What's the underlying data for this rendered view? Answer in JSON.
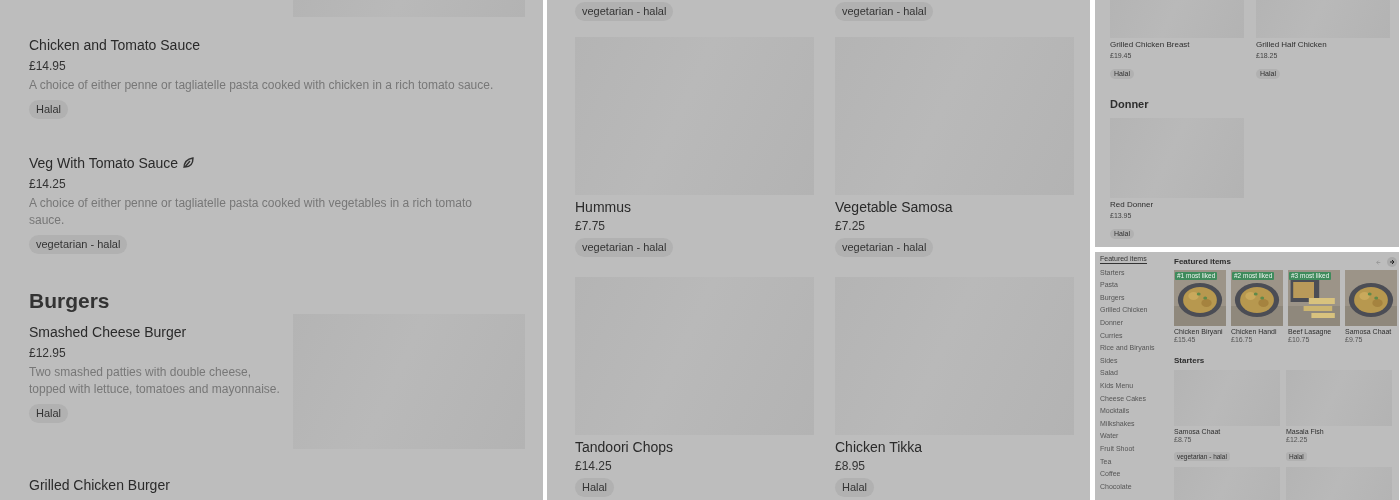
{
  "list_view": {
    "sections": [
      {
        "items": [
          {
            "kind": "cut",
            "has_image": true
          },
          {
            "kind": "full",
            "name": "Chicken and Tomato Sauce",
            "vegetarian": false,
            "price": "£14.95",
            "description": "A choice of either penne or tagliatelle pasta cooked with chicken in a rich tomato sauce.",
            "tags": [
              "Halal"
            ],
            "has_image": false
          },
          {
            "kind": "full",
            "name": "Veg With Tomato Sauce",
            "vegetarian": true,
            "price": "£14.25",
            "description": "A choice of either penne or tagliatelle pasta cooked with vegetables in a rich tomato sauce.",
            "tags": [
              "vegetarian - halal"
            ],
            "has_image": false
          }
        ]
      },
      {
        "heading": "Burgers",
        "items": [
          {
            "kind": "full",
            "name": "Smashed Cheese Burger",
            "vegetarian": false,
            "price": "£12.95",
            "description": "Two smashed patties with double cheese, topped with lettuce, tomatoes and mayonnaise.",
            "tags": [
              "Halal"
            ],
            "has_image": true
          },
          {
            "kind": "title_only",
            "name": "Grilled Chicken Burger"
          }
        ]
      }
    ]
  },
  "grid_view": {
    "rows": [
      [
        {
          "kind": "cut",
          "tags": [
            "vegetarian - halal"
          ]
        },
        {
          "kind": "cut",
          "tags": [
            "vegetarian - halal"
          ]
        }
      ],
      [
        {
          "kind": "full",
          "name": "Hummus",
          "price": "£7.75",
          "tags": [
            "vegetarian - halal"
          ]
        },
        {
          "kind": "full",
          "name": "Vegetable Samosa",
          "price": "£7.25",
          "tags": [
            "vegetarian - halal"
          ]
        }
      ],
      [
        {
          "kind": "full",
          "name": "Tandoori Chops",
          "price": "£14.25",
          "tags": [
            "Halal"
          ]
        },
        {
          "kind": "full",
          "name": "Chicken Tikka",
          "price": "£8.95",
          "tags": [
            "Halal"
          ]
        }
      ]
    ]
  },
  "small_grid_view": {
    "sections": [
      {
        "cards": [
          {
            "kind": "cut",
            "name": "Grilled Chicken Breast",
            "price": "£19.45",
            "tags": [
              "Halal"
            ]
          },
          {
            "kind": "cut",
            "name": "Grilled Half Chicken",
            "price": "£18.25",
            "tags": [
              "Halal"
            ]
          }
        ]
      },
      {
        "heading": "Donner",
        "cards": [
          {
            "kind": "full",
            "name": "Red Donner",
            "price": "£13.95",
            "tags": [
              "Halal"
            ]
          }
        ]
      }
    ]
  },
  "overview": {
    "sidebar": {
      "items": [
        {
          "label": "Featured items",
          "selected": true
        },
        {
          "label": "Starters",
          "selected": false
        },
        {
          "label": "Pasta",
          "selected": false
        },
        {
          "label": "Burgers",
          "selected": false
        },
        {
          "label": "Grilled Chicken",
          "selected": false
        },
        {
          "label": "Donner",
          "selected": false
        },
        {
          "label": "Curries",
          "selected": false
        },
        {
          "label": "Rice and Biryanis",
          "selected": false
        },
        {
          "label": "Sides",
          "selected": false
        },
        {
          "label": "Salad",
          "selected": false
        },
        {
          "label": "Kids Menu",
          "selected": false
        },
        {
          "label": "Cheese Cakes",
          "selected": false
        },
        {
          "label": "Mocktails",
          "selected": false
        },
        {
          "label": "Milkshakes",
          "selected": false
        },
        {
          "label": "Water",
          "selected": false
        },
        {
          "label": "Fruit Shoot",
          "selected": false
        },
        {
          "label": "Tea",
          "selected": false
        },
        {
          "label": "Coffee",
          "selected": false
        },
        {
          "label": "Chocolate",
          "selected": false
        }
      ]
    },
    "featured": {
      "heading": "Featured items",
      "prev_disabled": true,
      "next_disabled": false,
      "items": [
        {
          "name": "Chicken Biryani",
          "price": "£15.45",
          "badge": "#1 most liked"
        },
        {
          "name": "Chicken Handi",
          "price": "£16.75",
          "badge": "#2 most liked"
        },
        {
          "name": "Beef Lasagne",
          "price": "£10.75",
          "badge": "#3 most liked"
        },
        {
          "name": "Samosa Chaat",
          "price": "£9.75"
        }
      ]
    },
    "starters": {
      "heading": "Starters",
      "rows": [
        [
          {
            "kind": "full",
            "name": "Samosa Chaat",
            "price": "£8.75",
            "tags": [
              "vegetarian - halal"
            ]
          },
          {
            "kind": "full",
            "name": "Masala Fish",
            "price": "£12.25",
            "tags": [
              "Halal"
            ]
          }
        ],
        [
          {
            "kind": "image_only"
          },
          {
            "kind": "image_only"
          }
        ]
      ]
    }
  }
}
